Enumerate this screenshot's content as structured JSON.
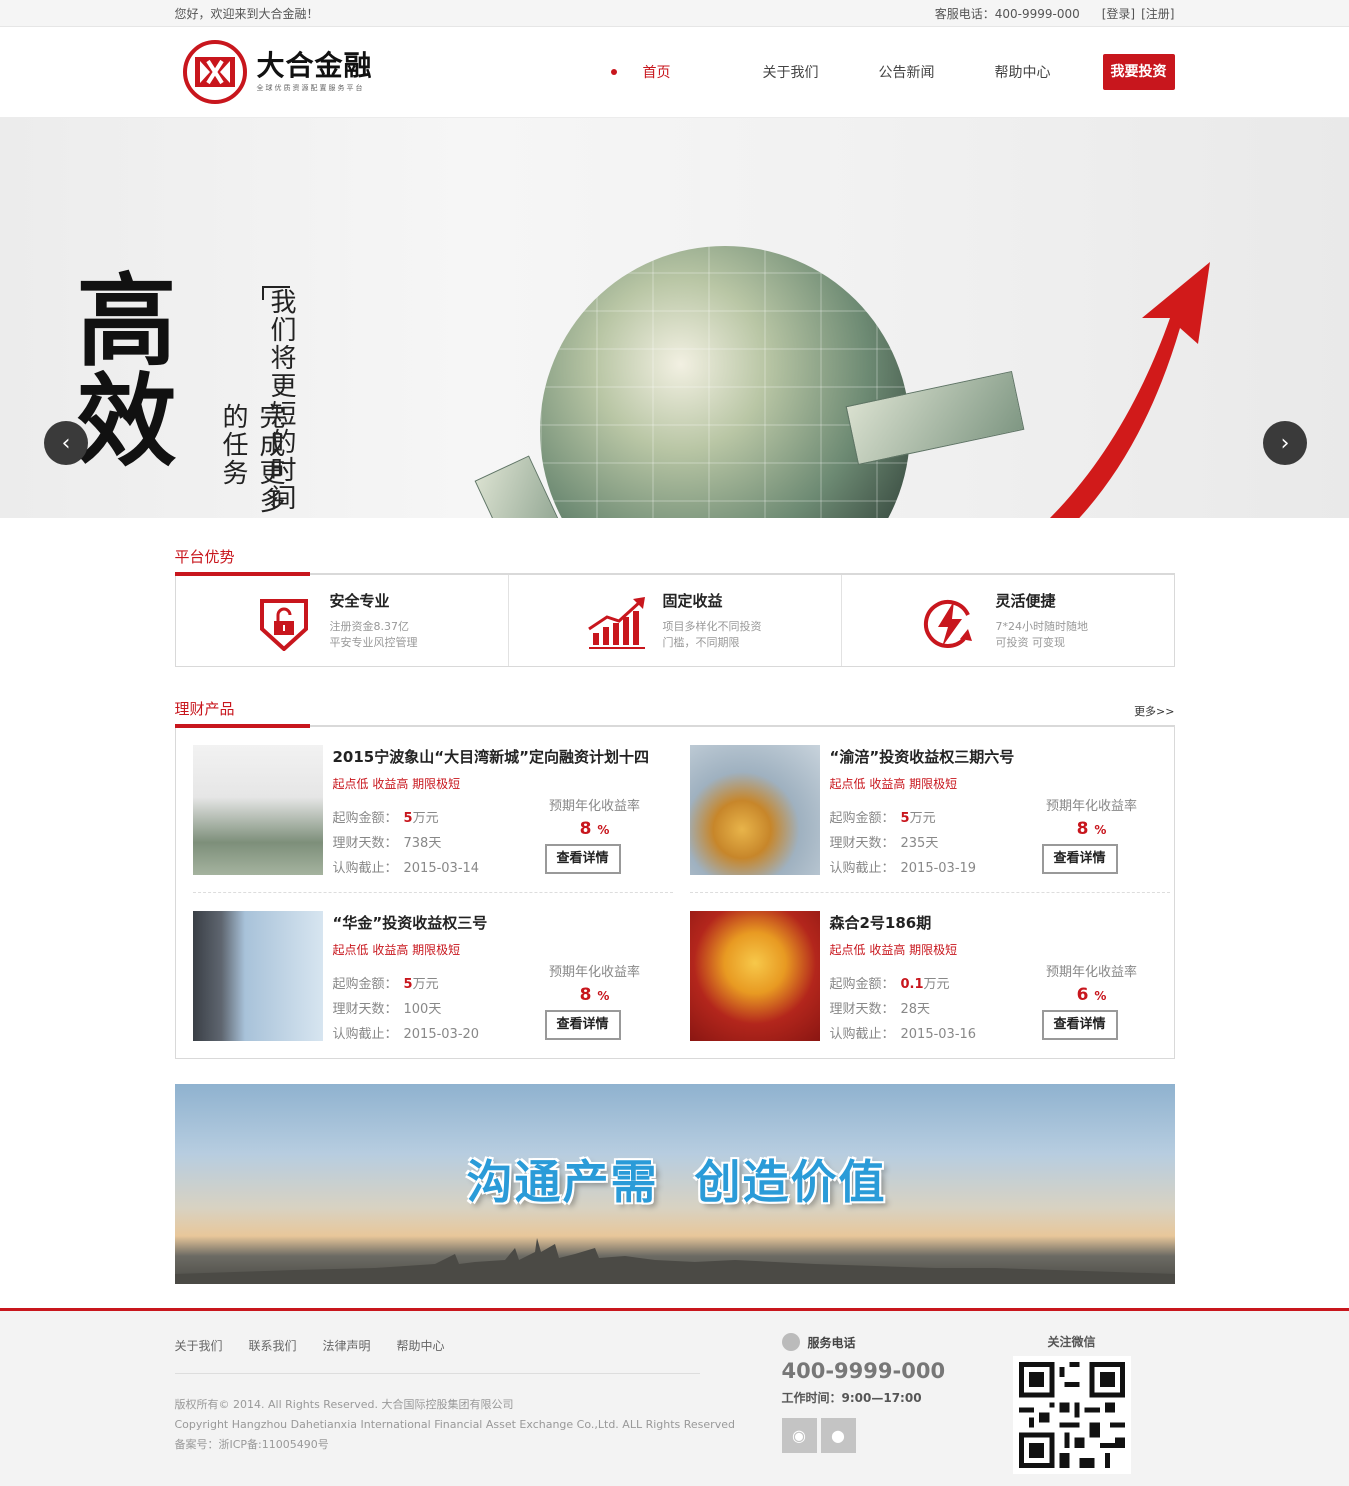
{
  "topbar": {
    "welcome": "您好，欢迎来到大合金融！",
    "service": "客服电话：400-9999-000",
    "login": "[登录]",
    "register": "[注册]"
  },
  "header": {
    "logo_name": "大合金融",
    "logo_slogan": "全球优质资源配置服务平台",
    "nav": [
      "首页",
      "关于我们",
      "公告新闻",
      "帮助中心"
    ],
    "invest_button": "我要投资"
  },
  "banner": {
    "calligraphy": "高效",
    "line1": "我们将更短的时间",
    "line2": "完成更多的任务",
    "dots": 3,
    "active_dot": 0
  },
  "advantages": {
    "title": "平台优势",
    "items": [
      {
        "icon": "shield-lock-icon",
        "title": "安全专业",
        "desc1": "注册资金8.37亿",
        "desc2": "平安专业风控管理"
      },
      {
        "icon": "rising-chart-icon",
        "title": "固定收益",
        "desc1": "项目多样化不同投资",
        "desc2": "门槛，不同期限"
      },
      {
        "icon": "lightning-refresh-icon",
        "title": "灵活便捷",
        "desc1": "7*24小时随时随地",
        "desc2": "可投资 可变现"
      }
    ]
  },
  "products": {
    "title": "理财产品",
    "more": "更多>>",
    "labels": {
      "tag": "起点低 收益高 期限极短",
      "amount": "起购金额：",
      "days": "理财天数：",
      "deadline": "认购截止：",
      "rate": "预期年化收益率",
      "detail": "查看详情"
    },
    "items": [
      {
        "name": "2015宁波象山“大目湾新城”定向融资计划十四",
        "amount": "5",
        "unit": "万元",
        "days": "738天",
        "deadline": "2015-03-14",
        "rate": "8",
        "pct": "%",
        "image": "money-hand-image"
      },
      {
        "name": "“渝涪”投资收益权三期六号",
        "amount": "5",
        "unit": "万元",
        "days": "235天",
        "deadline": "2015-03-19",
        "rate": "8",
        "pct": "%",
        "image": "dollar-sign-image"
      },
      {
        "name": "“华金”投资收益权三号",
        "amount": "5",
        "unit": "万元",
        "days": "100天",
        "deadline": "2015-03-20",
        "rate": "8",
        "pct": "%",
        "image": "building-key-image"
      },
      {
        "name": "森合2号186期",
        "amount": "0.1",
        "unit": "万元",
        "days": "28天",
        "deadline": "2015-03-16",
        "rate": "6",
        "pct": "%",
        "image": "golden-tree-image"
      }
    ]
  },
  "ad_banner": {
    "slogan": "沟通产需  创造价值"
  },
  "footer": {
    "links": [
      "关于我们",
      "联系我们",
      "法律声明",
      "帮助中心"
    ],
    "copy1": "版权所有© 2014. All Rights Reserved. 大合国际控股集团有限公司",
    "copy2": "Copyright Hangzhou Dahetianxia International Financial Asset Exchange Co.,Ltd. ALL Rights Reserved",
    "copy3": "备案号：浙ICP备:11005490号",
    "service_label": "服务电话",
    "tel": "400-9999-000",
    "hours": "工作时间：9:00—17:00",
    "wechat_label": "关注微信"
  },
  "colors": {
    "accent": "#c8161d",
    "text": "#333333",
    "muted": "#999999"
  }
}
